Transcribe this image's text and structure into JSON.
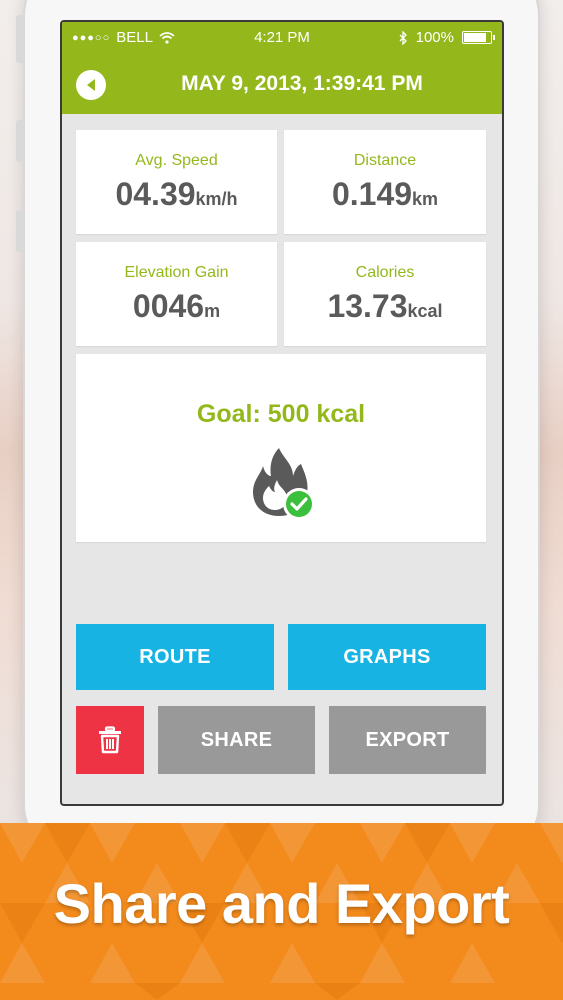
{
  "status_bar": {
    "carrier": "BELL",
    "time": "4:21 PM",
    "battery": "100%",
    "battery_level": 1.0
  },
  "header": {
    "title": "MAY 9, 2013, 1:39:41 PM"
  },
  "stats": [
    {
      "label": "Avg. Speed",
      "value": "04.39",
      "unit": "km/h"
    },
    {
      "label": "Distance",
      "value": "0.149",
      "unit": "km"
    },
    {
      "label": "Elevation Gain",
      "value": "0046",
      "unit": "m"
    },
    {
      "label": "Calories",
      "value": "13.73",
      "unit": "kcal"
    }
  ],
  "goal": {
    "text": "Goal: 500 kcal",
    "achieved": true
  },
  "buttons": {
    "route": "ROUTE",
    "graphs": "GRAPHS",
    "share": "SHARE",
    "export": "EXPORT"
  },
  "banner": {
    "caption": "Share and Export"
  },
  "colors": {
    "accent_green": "#94b81c",
    "button_blue": "#17b3e3",
    "button_gray": "#999999",
    "delete_red": "#ee3344",
    "banner_orange": "#f28a1c"
  }
}
